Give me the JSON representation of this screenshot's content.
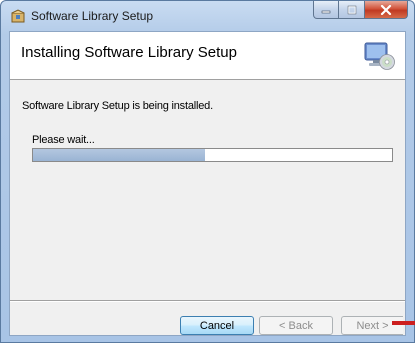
{
  "window": {
    "title": "Software Library Setup"
  },
  "banner": {
    "title": "Installing Software Library Setup",
    "icon": "computer-disc-icon"
  },
  "main": {
    "status_text": "Software Library Setup is being installed.",
    "wait_text": "Please wait...",
    "progress_fraction": 0.48
  },
  "buttons": {
    "cancel_label": "Cancel",
    "back_label": "< Back",
    "next_label": "Next >"
  },
  "colors": {
    "progress_fill": "#9ab4d4",
    "accent_marker": "#cc1f1f"
  }
}
